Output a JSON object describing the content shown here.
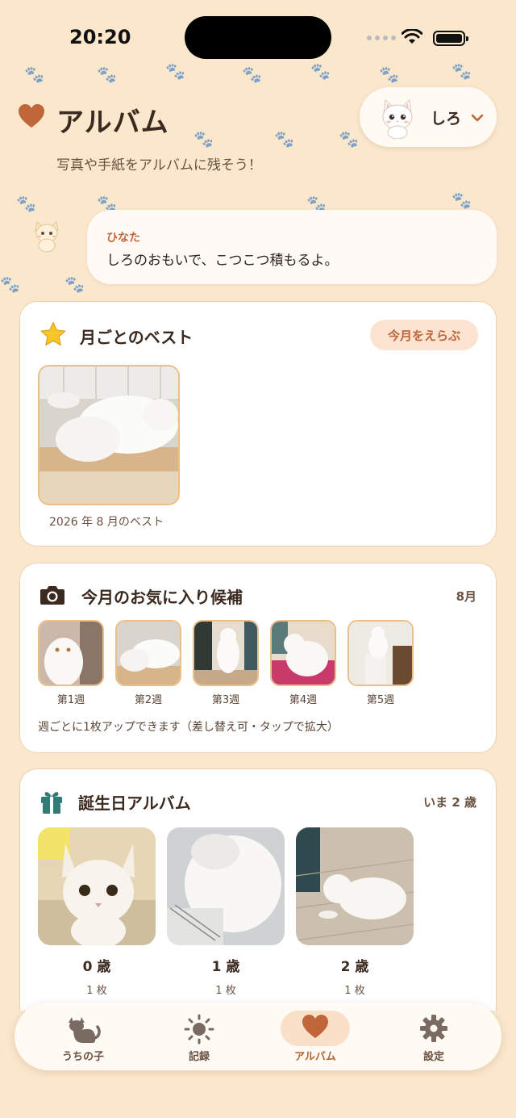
{
  "status_bar": {
    "time": "20:20"
  },
  "header": {
    "title": "アルバム",
    "subtitle": "写真や手紙をアルバムに残そう！",
    "pet_name": "しろ"
  },
  "message": {
    "speaker": "ひなた",
    "text": "しろのおもいで、こつこつ積もるよ。"
  },
  "best": {
    "title": "月ごとのベスト",
    "button": "今月をえらぶ",
    "caption": "2026 年 8 月のベスト"
  },
  "weekly": {
    "title": "今月のお気に入り候補",
    "month": "8月",
    "weeks": [
      "第1週",
      "第2週",
      "第3週",
      "第4週",
      "第5週"
    ],
    "note": "週ごとに1枚アップできます（差し替え可・タップで拡大）"
  },
  "birthday": {
    "title": "誕生日アルバム",
    "current_age": "いま 2 歳",
    "items": [
      {
        "age": "0 歳",
        "count": "1 枚"
      },
      {
        "age": "1 歳",
        "count": "1 枚"
      },
      {
        "age": "2 歳",
        "count": "1 枚"
      }
    ]
  },
  "tabs": [
    {
      "label": "うちの子",
      "icon": "cat-icon"
    },
    {
      "label": "記録",
      "icon": "sun-icon"
    },
    {
      "label": "アルバム",
      "icon": "heart-icon",
      "active": true
    },
    {
      "label": "設定",
      "icon": "gear-icon"
    }
  ],
  "colors": {
    "background": "#fbe7cc",
    "accent": "#c0673a",
    "card": "#ffffff"
  }
}
